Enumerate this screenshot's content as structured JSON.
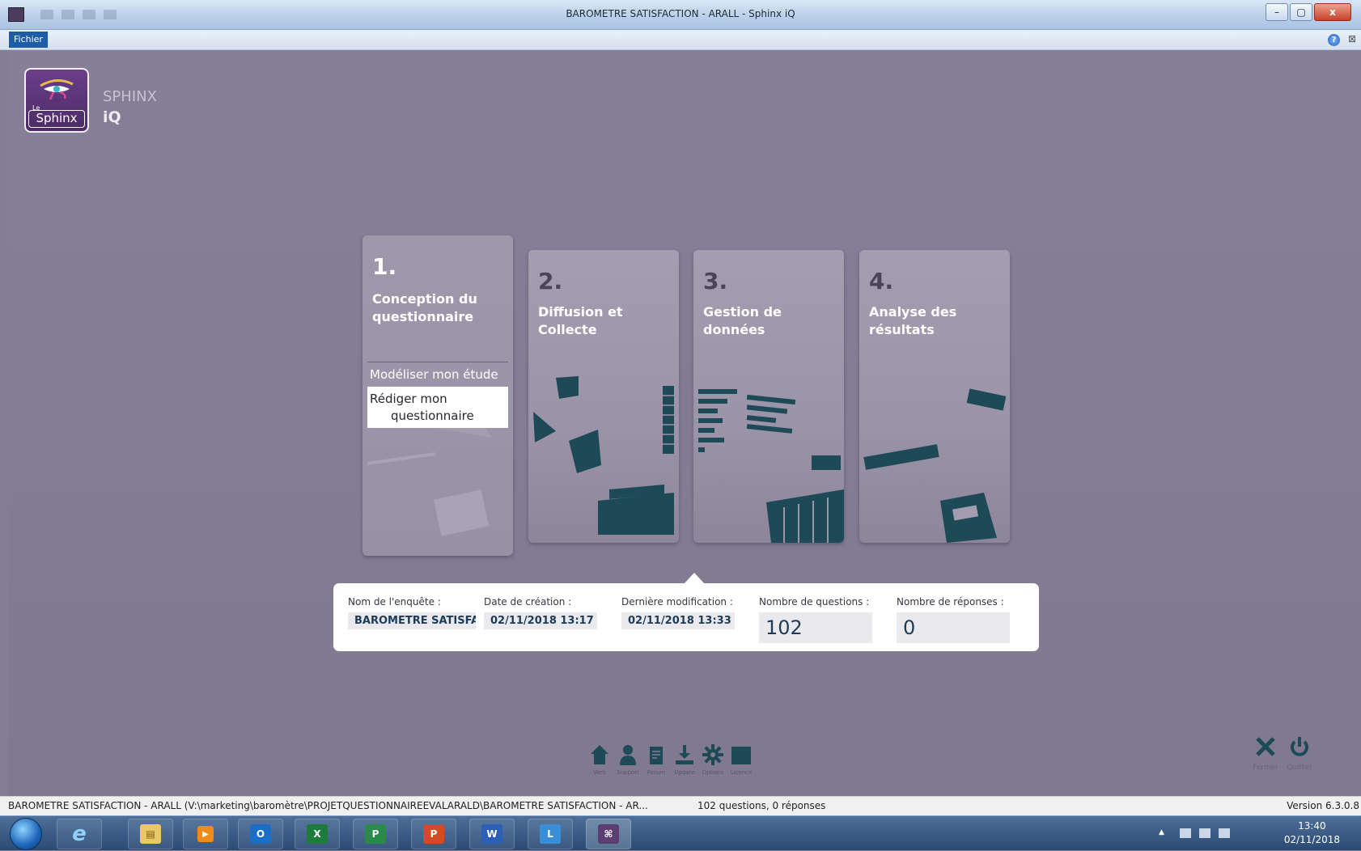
{
  "window": {
    "title": "BAROMETRE SATISFACTION - ARALL - Sphinx iQ",
    "buttons": {
      "minimize": "–",
      "maximize": "▢",
      "close": "x"
    }
  },
  "menu": {
    "file": "Fichier",
    "help": "?",
    "close": "⊠"
  },
  "brand": {
    "logo_le": "Le",
    "logo_text": "Sphinx",
    "name": "SPHINX",
    "sub": "iQ"
  },
  "cards": [
    {
      "number": "1.",
      "label": "Conception du questionnaire"
    },
    {
      "number": "2.",
      "label": "Diffusion et Collecte"
    },
    {
      "number": "3.",
      "label": "Gestion de données"
    },
    {
      "number": "4.",
      "label": "Analyse des résultats"
    }
  ],
  "submenu": {
    "model": "Modéliser mon étude",
    "write_line1": "Rédiger mon",
    "write_line2": "questionnaire"
  },
  "survey": {
    "name_label": "Nom de l'enquête :",
    "name": "BAROMETRE SATISFAC",
    "created_label": "Date de création :",
    "created": "02/11/2018 13:17",
    "modified_label": "Dernière modification :",
    "modified": "02/11/2018 13:33",
    "questions_label": "Nombre de questions :",
    "questions": "102",
    "responses_label": "Nombre de réponses :",
    "responses": "0"
  },
  "toolbar": {
    "web": "Web",
    "support": "Support",
    "forum": "Forum",
    "update": "Update",
    "options": "Options",
    "licence": "Licence",
    "fermer": "Fermer",
    "quitter": "Quitter"
  },
  "status": {
    "path": "BAROMETRE SATISFACTION - ARALL (V:\\marketing\\baromètre\\PROJETQUESTIONNAIREEVALARALD\\BAROMETRE SATISFACTION - AR...",
    "count": "102 questions, 0 réponses",
    "version": "Version 6.3.0.8"
  },
  "taskbar": {
    "apps": [
      "e",
      "▤",
      "▶",
      "O",
      "X",
      "P",
      "P",
      "W",
      "L",
      "⌘"
    ],
    "time": "13:40",
    "date": "02/11/2018"
  },
  "colors": {
    "background": "#857d93",
    "accent_dark": "#1e4a58",
    "file_menu": "#1e5ba8"
  }
}
